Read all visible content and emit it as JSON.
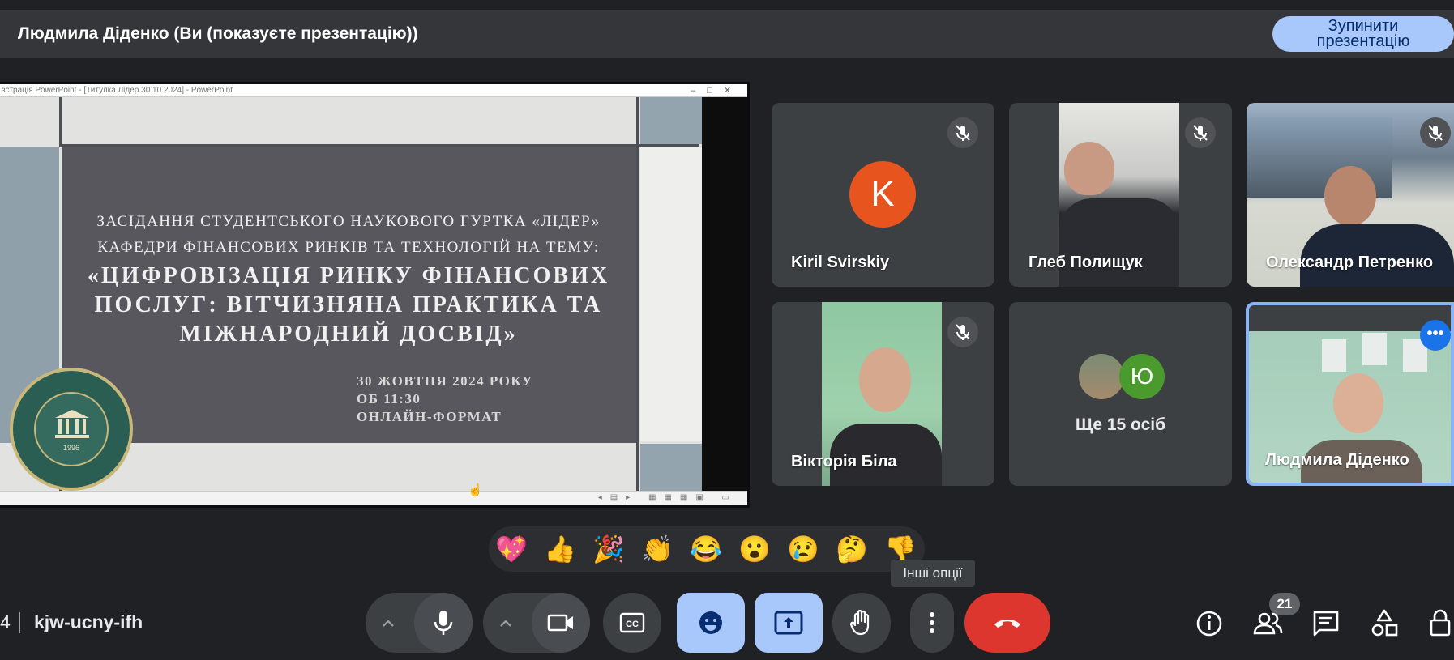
{
  "header": {
    "presenter_title": "Людмила Діденко (Ви (показуєте презентацію))",
    "stop_line1": "Зупинити",
    "stop_line2": "презентацію"
  },
  "powerpoint": {
    "window_title": "зстрація PowerPoint - [Титулка Лідер 30.10.2024] - PowerPoint",
    "slide": {
      "line1": "ЗАСІДАННЯ СТУДЕНТСЬКОГО НАУКОВОГО ГУРТКА «ЛІДЕР»",
      "line2": "КАФЕДРИ ФІНАНСОВИХ РИНКІВ ТА ТЕХНОЛОГІЙ НА ТЕМУ:",
      "main1": "«ЦИФРОВІЗАЦІЯ РИНКУ ФІНАНСОВИХ",
      "main2": "ПОСЛУГ: ВІТЧИЗНЯНА ПРАКТИКА ТА",
      "main3": "МІЖНАРОДНИЙ ДОСВІД»",
      "date": "30 ЖОВТНЯ 2024 РОКУ",
      "time": "ОБ 11:30",
      "format": "ОНЛАЙН-ФОРМАТ",
      "seal_year": "1996"
    }
  },
  "participants": [
    {
      "name": "Kiril Svirskiy",
      "avatar_letter": "K",
      "avatar_color": "#e8541e",
      "muted": true
    },
    {
      "name": "Глеб Полищук",
      "muted": true
    },
    {
      "name": "Олександр Петренко",
      "muted": true
    },
    {
      "name": "Вікторія Біла",
      "muted": true
    },
    {
      "name": "Ще 15 осіб",
      "avatar_letter": "Ю",
      "avatar_color": "#4a9a2e"
    },
    {
      "name": "Людмила Діденко",
      "active": true
    }
  ],
  "reactions": [
    "💖",
    "👍",
    "🎉",
    "👏",
    "😂",
    "😮",
    "😢",
    "🤔",
    "👎"
  ],
  "tooltip": "Інші опції",
  "footer": {
    "time_fragment": "4",
    "meeting_code": "kjw-ucny-ifh",
    "participant_count": "21"
  },
  "colors": {
    "background": "#202124",
    "accent_blue": "#a8c7fa",
    "end_call_red": "#dc362e",
    "active_border": "#8ab4f8"
  }
}
